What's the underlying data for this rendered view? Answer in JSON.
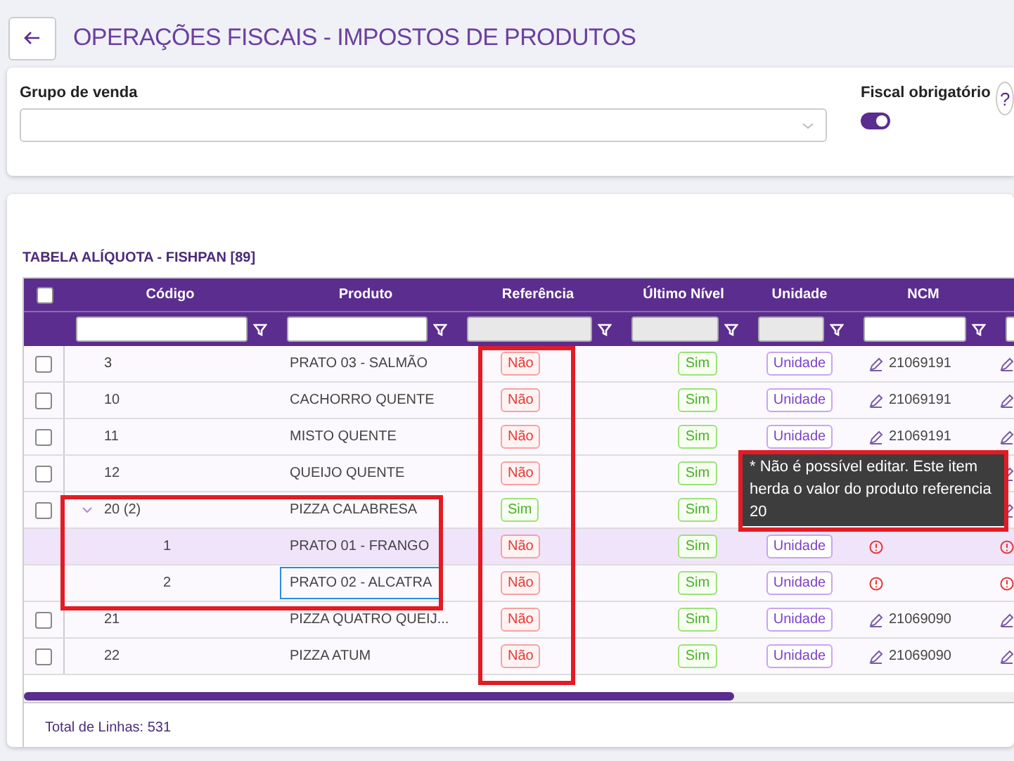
{
  "header": {
    "title": "OPERAÇÕES FISCAIS - IMPOSTOS DE PRODUTOS"
  },
  "filters": {
    "group_label": "Grupo de venda",
    "fiscal_label": "Fiscal obrigatório",
    "fiscal_on": true,
    "help_text": "?"
  },
  "table": {
    "title": "TABELA ALÍQUOTA - FISHPAN [89]",
    "header_checked": false,
    "columns": [
      {
        "label": "Código",
        "filter_disabled": false
      },
      {
        "label": "Produto",
        "filter_disabled": false
      },
      {
        "label": "Referência",
        "filter_disabled": true
      },
      {
        "label": "Último Nível",
        "filter_disabled": true
      },
      {
        "label": "Unidade",
        "filter_disabled": true
      },
      {
        "label": "NCM",
        "filter_disabled": false
      },
      {
        "filter_disabled": false
      }
    ],
    "rows": [
      {
        "checked": false,
        "code": "3",
        "product": "PRATO 03 - SALMÃO",
        "reference": {
          "text": "Não",
          "positive": false
        },
        "last_level": {
          "text": "Sim",
          "positive": true
        },
        "unit": "Unidade",
        "ncm": {
          "kind": "edit",
          "text": "21069191"
        },
        "column_8": {
          "kind": "edit"
        }
      },
      {
        "checked": false,
        "code": "10",
        "product": "CACHORRO QUENTE",
        "reference": {
          "text": "Não",
          "positive": false
        },
        "last_level": {
          "text": "Sim",
          "positive": true
        },
        "unit": "Unidade",
        "ncm": {
          "kind": "edit",
          "text": "21069191"
        },
        "column_8": {
          "kind": "edit"
        }
      },
      {
        "checked": false,
        "code": "11",
        "product": "MISTO QUENTE",
        "reference": {
          "text": "Não",
          "positive": false
        },
        "last_level": {
          "text": "Sim",
          "positive": true
        },
        "unit": "Unidade",
        "ncm": {
          "kind": "edit",
          "text": "21069191"
        },
        "column_8": {
          "kind": "edit"
        }
      },
      {
        "checked": false,
        "code": "12",
        "product": "QUEIJO QUENTE",
        "reference": {
          "text": "Não",
          "positive": false
        },
        "last_level": {
          "text": "Sim",
          "positive": true
        },
        "column_8": {
          "kind": "edit"
        }
      },
      {
        "checked": false,
        "code": "20 (2)",
        "product": "PIZZA CALABRESA",
        "reference": {
          "text": "Sim",
          "positive": true
        },
        "last_level": {
          "text": "Sim",
          "positive": true
        },
        "column_8": {
          "kind": "edit"
        },
        "expanded": true,
        "children": [
          {
            "code": "1",
            "product": "PRATO 01 - FRANGO",
            "selected": true,
            "focused": false,
            "reference": {
              "text": "Não",
              "positive": false
            },
            "last_level": {
              "text": "Sim",
              "positive": true
            },
            "unit": "Unidade",
            "ncm": {
              "kind": "error"
            },
            "column_8": {
              "kind": "error"
            }
          },
          {
            "code": "2",
            "product": "PRATO 02 - ALCATRA",
            "selected": false,
            "focused": true,
            "reference": {
              "text": "Não",
              "positive": false
            },
            "last_level": {
              "text": "Sim",
              "positive": true
            },
            "unit": "Unidade",
            "ncm": {
              "kind": "error"
            },
            "column_8": {
              "kind": "error"
            }
          }
        ]
      },
      {
        "checked": false,
        "code": "21",
        "product": "PIZZA QUATRO QUEIJ...",
        "reference": {
          "text": "Não",
          "positive": false
        },
        "last_level": {
          "text": "Sim",
          "positive": true
        },
        "unit": "Unidade",
        "ncm": {
          "kind": "edit",
          "text": "21069090"
        },
        "column_8": {
          "kind": "edit"
        }
      },
      {
        "checked": false,
        "code": "22",
        "product": "PIZZA ATUM",
        "reference": {
          "text": "Não",
          "positive": false
        },
        "last_level": {
          "text": "Sim",
          "positive": true
        },
        "unit": "Unidade",
        "ncm": {
          "kind": "edit",
          "text": "21069090"
        },
        "column_8": {
          "kind": "edit"
        }
      }
    ],
    "total": "Total de Linhas: 531"
  },
  "tooltip": {
    "text": "* Não é possível editar. Este item herda o valor do produto referencia 20"
  }
}
